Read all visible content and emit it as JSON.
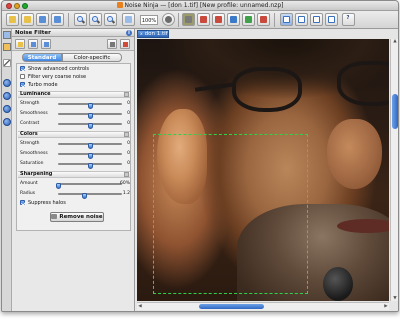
{
  "window": {
    "title": "Noise Ninja — [don 1.tif] [New profile: unnamed.nzp]"
  },
  "toolbar": {
    "zoom_level": "100%",
    "button_colors": [
      "#e8c14a",
      "#5a8fd8",
      "#5a8fd8",
      "#7a7a7a",
      "#c94a3c",
      "#c94a3c",
      "#3a7ac9",
      "#3ea149",
      "#c94a3c"
    ],
    "help_glyph": "?"
  },
  "panel": {
    "title": "Noise Filter",
    "info_glyph": "i",
    "tabs": [
      "Standard",
      "Color-specific"
    ],
    "options": [
      {
        "label": "Show advanced controls",
        "checked": true
      },
      {
        "label": "Filter very coarse noise",
        "checked": false
      },
      {
        "label": "Turbo mode",
        "checked": true
      }
    ],
    "luminance": {
      "heading": "Luminance",
      "sliders": [
        {
          "label": "Strength",
          "value": "0"
        },
        {
          "label": "Smoothness",
          "value": "0"
        },
        {
          "label": "Contrast",
          "value": "0"
        }
      ]
    },
    "colors": {
      "heading": "Colors",
      "sliders": [
        {
          "label": "Strength",
          "value": "0"
        },
        {
          "label": "Smoothness",
          "value": "0"
        },
        {
          "label": "Saturation",
          "value": "0"
        }
      ]
    },
    "sharpening": {
      "heading": "Sharpening",
      "sliders": [
        {
          "label": "Amount",
          "value": "60%"
        },
        {
          "label": "Radius",
          "value": "1.2"
        }
      ]
    },
    "suppress_halos": {
      "label": "Suppress halos",
      "checked": true
    },
    "remove_noise_label": "Remove noise"
  },
  "document": {
    "tab_label": "don 1.tif",
    "close_glyph": "x"
  },
  "accent_color": "#3f86e0"
}
